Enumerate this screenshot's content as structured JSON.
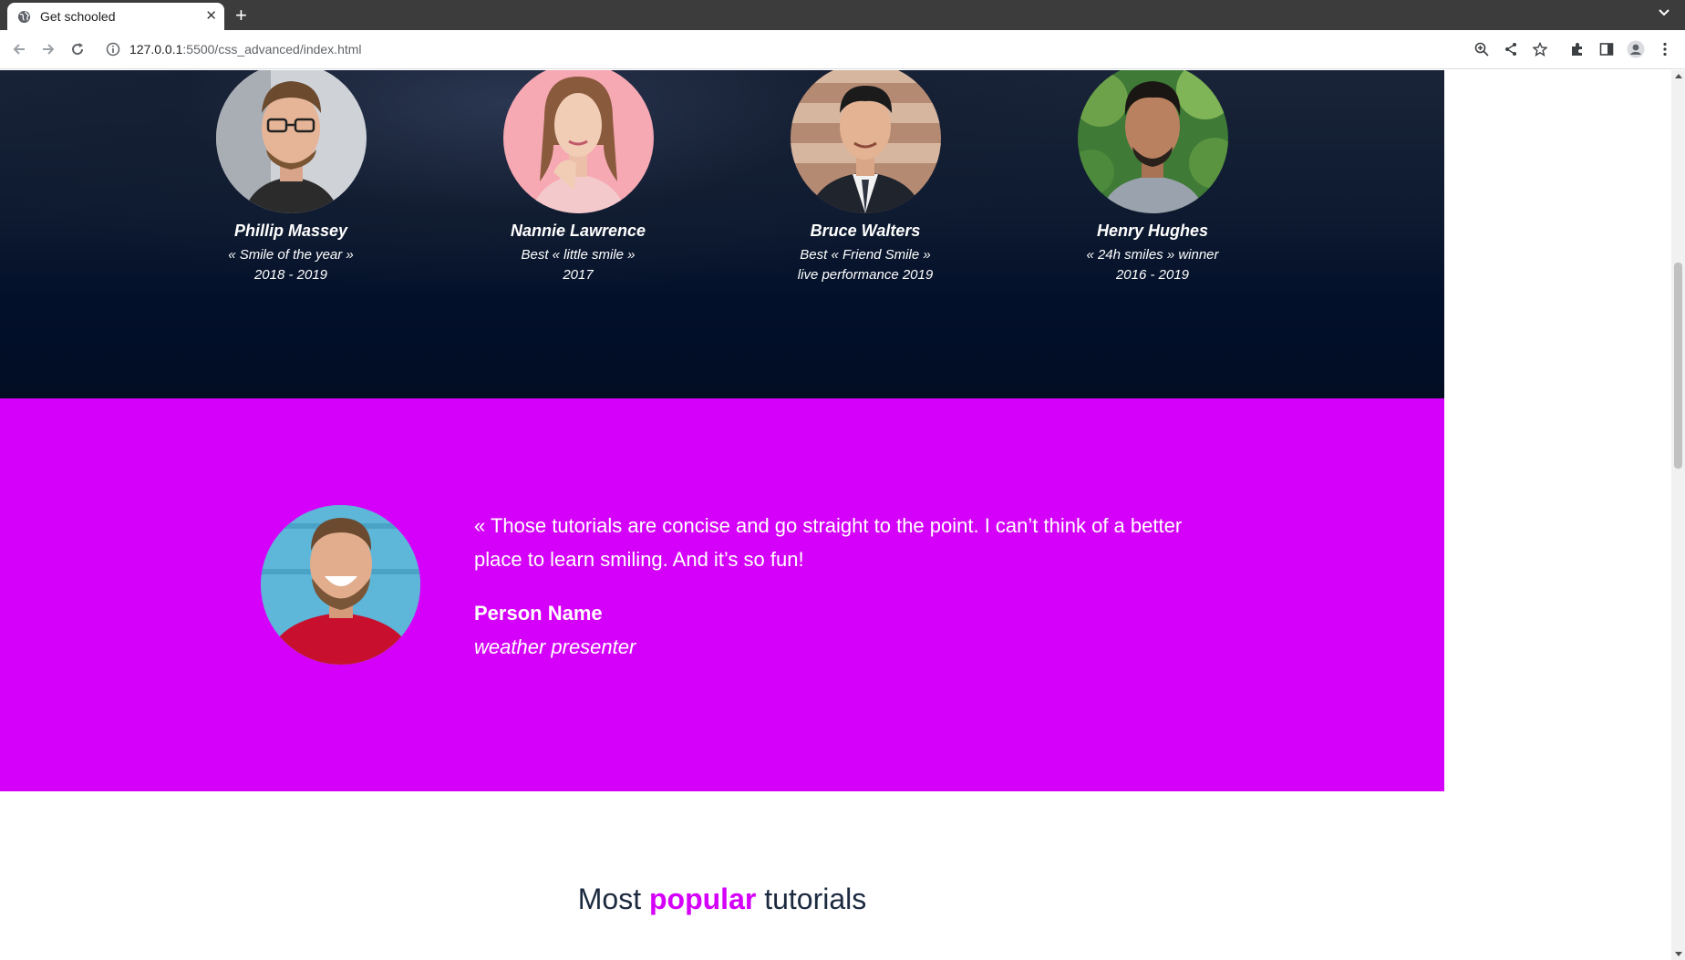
{
  "browser": {
    "tab_title": "Get schooled",
    "url_host": "127.0.0.1",
    "url_rest": ":5500/css_advanced/index.html"
  },
  "team": {
    "members": [
      {
        "name": "Phillip Massey",
        "award_line1": "« Smile of the year »",
        "award_line2": "2018 - 2019"
      },
      {
        "name": "Nannie Lawrence",
        "award_line1": "Best « little smile »",
        "award_line2": "2017"
      },
      {
        "name": "Bruce Walters",
        "award_line1": "Best « Friend Smile »",
        "award_line2": "live performance 2019"
      },
      {
        "name": "Henry Hughes",
        "award_line1": "« 24h smiles » winner",
        "award_line2": "2016 - 2019"
      }
    ]
  },
  "testimonial": {
    "quote": "« Those tutorials are concise and go straight to the point. I can’t think of a better place to learn smiling. And it’s so fun!",
    "name": "Person Name",
    "role": "weather presenter"
  },
  "popular": {
    "title_before": "Most",
    "title_accent": "popular",
    "title_after": "tutorials"
  },
  "colors": {
    "accent": "#d500f9",
    "dark": "#03102a"
  }
}
